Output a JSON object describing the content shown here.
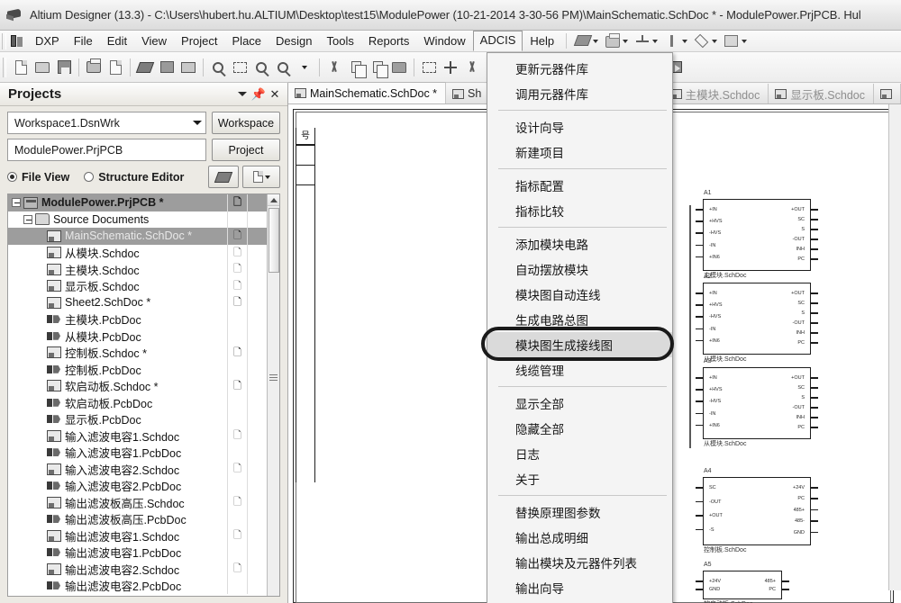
{
  "window": {
    "title": "Altium Designer (13.3) - C:\\Users\\hubert.hu.ALTIUM\\Desktop\\test15\\ModulePower (10-21-2014 3-30-56 PM)\\MainSchematic.SchDoc * - ModulePower.PrjPCB. Hul",
    "app_icon": "altium-pen-icon"
  },
  "menubar": {
    "logo_icon": "dxp-logo-icon",
    "items": [
      {
        "label": "DXP",
        "active": false
      },
      {
        "label": "File",
        "active": false
      },
      {
        "label": "Edit",
        "active": false
      },
      {
        "label": "View",
        "active": false
      },
      {
        "label": "Project",
        "active": false
      },
      {
        "label": "Place",
        "active": false
      },
      {
        "label": "Design",
        "active": false
      },
      {
        "label": "Tools",
        "active": false
      },
      {
        "label": "Reports",
        "active": false
      },
      {
        "label": "Window",
        "active": false
      },
      {
        "label": "ADCIS",
        "active": true
      },
      {
        "label": "Help",
        "active": false
      }
    ],
    "tool_icons": [
      "stack-icon",
      "printer-icon",
      "ground-icon",
      "pin-icon",
      "port-icon",
      "grid-icon"
    ]
  },
  "toolbar": {
    "icons": [
      "new-document-icon",
      "open-folder-icon",
      "save-icon",
      "print-icon",
      "print-preview-icon",
      "pcb-layers-icon",
      "board-3d-icon",
      "sheet-icon",
      "zoom-document-icon",
      "zoom-area-icon",
      "zoom-in-icon",
      "zoom-selected-icon",
      "cut-icon",
      "copy-icon",
      "paste-icon",
      "paste-special-icon",
      "select-region-icon",
      "move-icon",
      "cross-probe-icon",
      "place-wire-icon",
      "place-bus-icon",
      "place-line-icon",
      "net-label-icon",
      "gnd-power-icon",
      "vcc-power-icon",
      "place-port-icon",
      "sheet-symbol-icon",
      "sheet-entry-icon"
    ]
  },
  "projects_panel": {
    "title": "Projects",
    "header_buttons": [
      "chevron-down-icon",
      "pin-icon",
      "close-icon"
    ],
    "workspace_combo_value": "Workspace1.DsnWrk",
    "workspace_button": "Workspace",
    "project_combo_value": "ModulePower.PrjPCB",
    "project_button": "Project",
    "view_modes": [
      {
        "label": "File View",
        "selected": true
      },
      {
        "label": "Structure Editor",
        "selected": false
      }
    ],
    "panel_buttons": [
      "layers-icon",
      "document-options-icon"
    ],
    "tree": [
      {
        "label": "ModulePower.PrjPCB *",
        "indent": 0,
        "icon": "project-icon",
        "expander": true,
        "selected": "bold",
        "doc_mark": "dark"
      },
      {
        "label": "Source Documents",
        "indent": 1,
        "icon": "folder-icon",
        "expander": true,
        "selected": "none",
        "doc_mark": "none"
      },
      {
        "label": "MainSchematic.SchDoc *",
        "indent": 2,
        "icon": "schematic-icon",
        "expander": false,
        "selected": "active",
        "doc_mark": "dark"
      },
      {
        "label": "从模块.Schdoc",
        "indent": 2,
        "icon": "schematic-icon",
        "expander": false,
        "selected": "none",
        "doc_mark": "light"
      },
      {
        "label": "主模块.Schdoc",
        "indent": 2,
        "icon": "schematic-icon",
        "expander": false,
        "selected": "none",
        "doc_mark": "light"
      },
      {
        "label": "显示板.Schdoc",
        "indent": 2,
        "icon": "schematic-icon",
        "expander": false,
        "selected": "none",
        "doc_mark": "light"
      },
      {
        "label": "Sheet2.SchDoc *",
        "indent": 2,
        "icon": "schematic-icon",
        "expander": false,
        "selected": "none",
        "doc_mark": "dark"
      },
      {
        "label": "主模块.PcbDoc",
        "indent": 2,
        "icon": "pcb-icon",
        "expander": false,
        "selected": "none",
        "doc_mark": "none"
      },
      {
        "label": "从模块.PcbDoc",
        "indent": 2,
        "icon": "pcb-icon",
        "expander": false,
        "selected": "none",
        "doc_mark": "none"
      },
      {
        "label": "控制板.Schdoc *",
        "indent": 2,
        "icon": "schematic-icon",
        "expander": false,
        "selected": "none",
        "doc_mark": "dark"
      },
      {
        "label": "控制板.PcbDoc",
        "indent": 2,
        "icon": "pcb-icon",
        "expander": false,
        "selected": "none",
        "doc_mark": "none"
      },
      {
        "label": "软启动板.Schdoc *",
        "indent": 2,
        "icon": "schematic-icon",
        "expander": false,
        "selected": "none",
        "doc_mark": "dark"
      },
      {
        "label": "软启动板.PcbDoc",
        "indent": 2,
        "icon": "pcb-icon",
        "expander": false,
        "selected": "none",
        "doc_mark": "none"
      },
      {
        "label": "显示板.PcbDoc",
        "indent": 2,
        "icon": "pcb-icon",
        "expander": false,
        "selected": "none",
        "doc_mark": "none"
      },
      {
        "label": "输入滤波电容1.Schdoc",
        "indent": 2,
        "icon": "schematic-icon",
        "expander": false,
        "selected": "none",
        "doc_mark": "light"
      },
      {
        "label": "输入滤波电容1.PcbDoc",
        "indent": 2,
        "icon": "pcb-icon",
        "expander": false,
        "selected": "none",
        "doc_mark": "none"
      },
      {
        "label": "输入滤波电容2.Schdoc",
        "indent": 2,
        "icon": "schematic-icon",
        "expander": false,
        "selected": "none",
        "doc_mark": "light"
      },
      {
        "label": "输入滤波电容2.PcbDoc",
        "indent": 2,
        "icon": "pcb-icon",
        "expander": false,
        "selected": "none",
        "doc_mark": "none"
      },
      {
        "label": "输出滤波板高压.Schdoc",
        "indent": 2,
        "icon": "schematic-icon",
        "expander": false,
        "selected": "none",
        "doc_mark": "light"
      },
      {
        "label": "输出滤波板高压.PcbDoc",
        "indent": 2,
        "icon": "pcb-icon",
        "expander": false,
        "selected": "none",
        "doc_mark": "none"
      },
      {
        "label": "输出滤波电容1.Schdoc",
        "indent": 2,
        "icon": "schematic-icon",
        "expander": false,
        "selected": "none",
        "doc_mark": "light"
      },
      {
        "label": "输出滤波电容1.PcbDoc",
        "indent": 2,
        "icon": "pcb-icon",
        "expander": false,
        "selected": "none",
        "doc_mark": "none"
      },
      {
        "label": "输出滤波电容2.Schdoc",
        "indent": 2,
        "icon": "schematic-icon",
        "expander": false,
        "selected": "none",
        "doc_mark": "light"
      },
      {
        "label": "输出滤波电容2.PcbDoc",
        "indent": 2,
        "icon": "pcb-icon",
        "expander": false,
        "selected": "none",
        "doc_mark": "none"
      }
    ]
  },
  "document_tabs": [
    {
      "label": "MainSchematic.SchDoc *",
      "active": true,
      "dim": false
    },
    {
      "label": "Sh",
      "active": false,
      "dim": false
    },
    {
      "label": "主模块.Schdoc",
      "active": false,
      "dim": true
    },
    {
      "label": "显示板.Schdoc",
      "active": false,
      "dim": true
    }
  ],
  "adcis_menu": {
    "items": [
      {
        "label": "更新元器件库",
        "type": "item",
        "highlight": false
      },
      {
        "label": "调用元器件库",
        "type": "item",
        "highlight": false
      },
      {
        "type": "separator"
      },
      {
        "label": "设计向导",
        "type": "item",
        "highlight": false
      },
      {
        "label": "新建项目",
        "type": "item",
        "highlight": false
      },
      {
        "type": "separator"
      },
      {
        "label": "指标配置",
        "type": "item",
        "highlight": false
      },
      {
        "label": "指标比较",
        "type": "item",
        "highlight": false
      },
      {
        "type": "separator"
      },
      {
        "label": "添加模块电路",
        "type": "item",
        "highlight": false
      },
      {
        "label": "自动摆放模块",
        "type": "item",
        "highlight": false
      },
      {
        "label": "模块图自动连线",
        "type": "item",
        "highlight": false
      },
      {
        "label": "生成电路总图",
        "type": "item",
        "highlight": false
      },
      {
        "label": "模块图生成接线图",
        "type": "item",
        "highlight": true
      },
      {
        "label": "线缆管理",
        "type": "item",
        "highlight": false
      },
      {
        "type": "separator"
      },
      {
        "label": "显示全部",
        "type": "item",
        "highlight": false
      },
      {
        "label": "隐藏全部",
        "type": "item",
        "highlight": false
      },
      {
        "label": "日志",
        "type": "item",
        "highlight": false
      },
      {
        "label": "关于",
        "type": "item",
        "highlight": false
      },
      {
        "type": "separator"
      },
      {
        "label": "替换原理图参数",
        "type": "item",
        "highlight": false
      },
      {
        "label": "输出总成明细",
        "type": "item",
        "highlight": false
      },
      {
        "label": "输出模块及元器件列表",
        "type": "item",
        "highlight": false
      },
      {
        "label": "输出向导",
        "type": "item",
        "highlight": false
      }
    ]
  },
  "canvas": {
    "revision_table_header": "号",
    "blocks": [
      {
        "refdes": "A1",
        "caption": "主模块.SchDoc",
        "left_pins": [
          "+IN",
          "+HVS",
          "-HVS",
          "-IN",
          "+IN6"
        ],
        "right_pins": [
          "+OUT",
          "SC",
          "S",
          "-OUT",
          "INH",
          "PC"
        ]
      },
      {
        "refdes": "A2",
        "caption": "从模块.SchDoc",
        "left_pins": [
          "+IN",
          "+HVS",
          "-HVS",
          "-IN",
          "+IN6"
        ],
        "right_pins": [
          "+OUT",
          "SC",
          "S",
          "-OUT",
          "INH",
          "PC"
        ]
      },
      {
        "refdes": "A3",
        "caption": "从模块.SchDoc",
        "left_pins": [
          "+IN",
          "+HVS",
          "-HVS",
          "-IN",
          "+IN6"
        ],
        "right_pins": [
          "+OUT",
          "SC",
          "S",
          "-OUT",
          "INH",
          "PC"
        ]
      },
      {
        "refdes": "A4",
        "caption": "控制板.SchDoc",
        "left_pins": [
          "SC",
          "-OUT",
          "+OUT",
          "-S"
        ],
        "right_pins": [
          "+24V",
          "PC",
          "485+",
          "485-",
          "GND"
        ]
      },
      {
        "refdes": "A5",
        "caption": "软启动板.SchDoc",
        "left_pins": [
          "+24V",
          "GND"
        ],
        "right_pins": [
          "485+",
          "PC"
        ]
      }
    ]
  }
}
